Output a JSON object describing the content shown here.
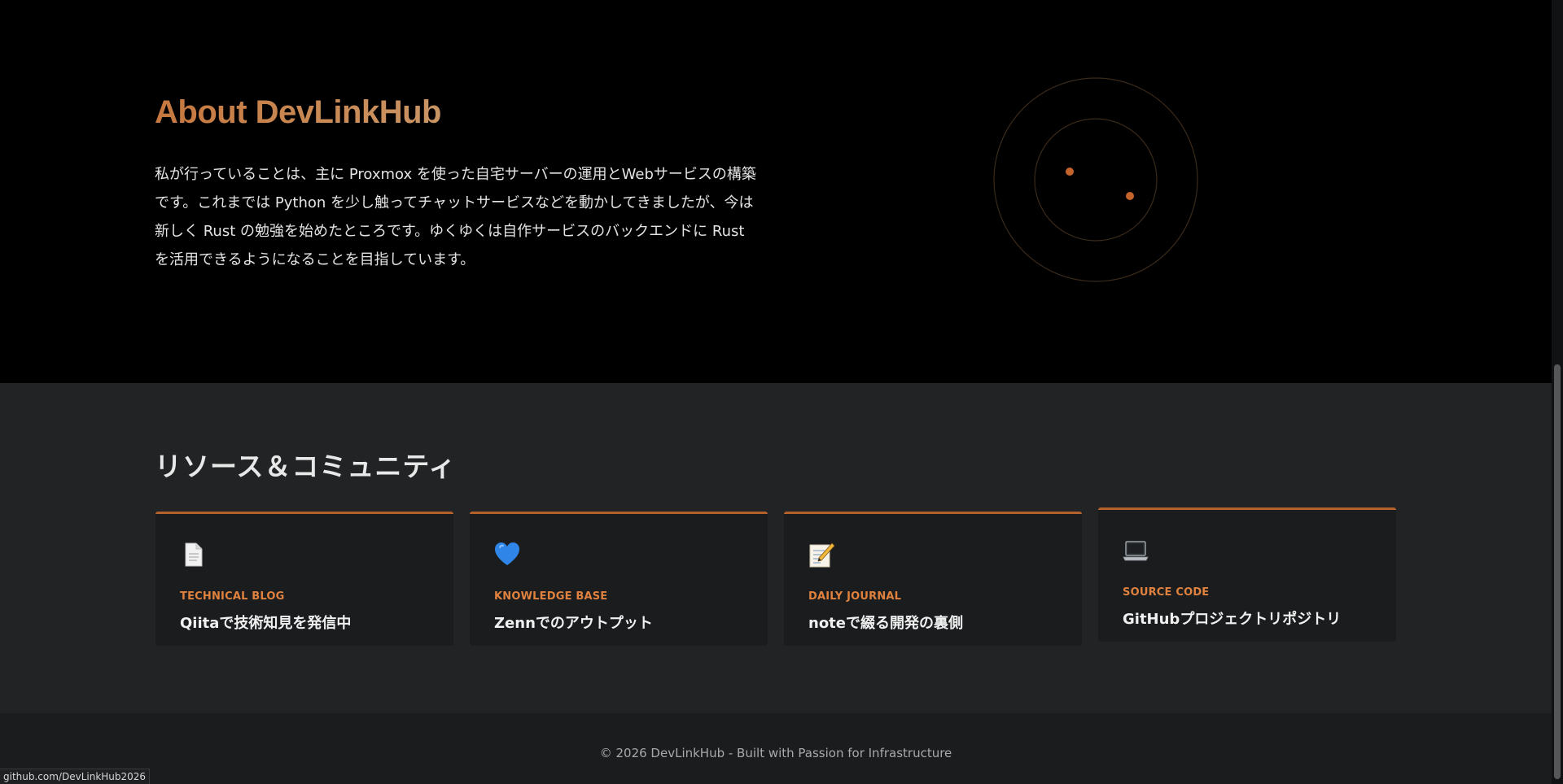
{
  "about": {
    "title": "About DevLinkHub",
    "body": "私が行っていることは、主に Proxmox を使った自宅サーバーの運用とWebサービスの構築です。これまでは Python を少し触ってチャットサービスなどを動かしてきましたが、今は新しく Rust の勉強を始めたところです。ゆくゆくは自作サービスのバックエンドに Rust を活用できるようになることを目指しています。"
  },
  "resources": {
    "title": "リソース＆コミュニティ",
    "cards": [
      {
        "icon": "document-icon",
        "label": "TECHNICAL BLOG",
        "desc": "Qiitaで技術知見を発信中"
      },
      {
        "icon": "blue-heart-icon",
        "label": "KNOWLEDGE BASE",
        "desc": "Zennでのアウトプット"
      },
      {
        "icon": "memo-icon",
        "label": "DAILY JOURNAL",
        "desc": "noteで綴る開発の裏側"
      },
      {
        "icon": "laptop-icon",
        "label": "SOURCE CODE",
        "desc": "GitHubプロジェクトリポジトリ"
      }
    ]
  },
  "footer": {
    "text": "© 2026 DevLinkHub - Built with Passion for Infrastructure"
  },
  "status_bar": {
    "url": "github.com/DevLinkHub2026"
  },
  "colors": {
    "accent": "#b4612b",
    "label": "#e0823e",
    "section_bg": "#212325",
    "card_bg": "#1a1c1e"
  }
}
